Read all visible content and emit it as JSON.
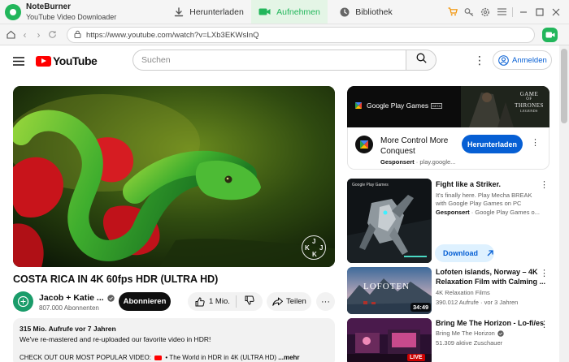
{
  "app": {
    "name": "NoteBurner",
    "subtitle": "YouTube Video Downloader",
    "tabs": [
      {
        "label": "Herunterladen",
        "icon": "download-icon"
      },
      {
        "label": "Aufnehmen",
        "icon": "camera-icon",
        "active": true
      },
      {
        "label": "Bibliothek",
        "icon": "clock-icon"
      }
    ],
    "accent": "#22b65b"
  },
  "browser": {
    "url": "https://www.youtube.com/watch?v=LXb3EKWsInQ"
  },
  "youtube": {
    "logo": "YouTube",
    "search_placeholder": "Suchen",
    "signin_label": "Anmelden"
  },
  "video": {
    "title": "COSTA RICA IN 4K 60fps HDR (ULTRA HD)",
    "channel": "Jacob + Katie ...",
    "subscribers": "807.000 Abonnenten",
    "subscribe_label": "Abonnieren",
    "likes": "1 Mio.",
    "share_label": "Teilen",
    "watermark": {
      "top": "J",
      "left": "K",
      "right": "J",
      "bottom": "K"
    }
  },
  "description": {
    "meta": "315 Mio. Aufrufe  vor 7 Jahren",
    "line1": "We've re-mastered and re-uploaded our favorite video in HDR!",
    "line2_a": "CHECK OUT OUR MOST POPULAR VIDEO:",
    "line2_b": "• The World in HDR in 4K (ULTRA HD)",
    "more": "...mehr"
  },
  "ad": {
    "banner_brand": "Google Play Games",
    "banner_beta": "BETA",
    "banner_game": [
      "GAME",
      "OF",
      "THRONES",
      "LEGENDS"
    ],
    "title": "More Control More Conquest",
    "sponsored": "Gesponsert",
    "domain": "play.google...",
    "button": "Herunterladen"
  },
  "sidebar": [
    {
      "title": "Fight like a Striker.",
      "desc1": "It's finally here. Play Mecha BREAK",
      "desc2": "with Google Play Games on PC",
      "sponsored": "Gesponsert",
      "meta": "Google Play Games o...",
      "button": "Download"
    },
    {
      "title_line1": "Lofoten islands, Norway – 4K",
      "title_line2": "Relaxation Film with Calming ...",
      "channel": "4K Relaxation Films",
      "views": "390.012 Aufrufe",
      "age": "vor 3 Jahren",
      "duration": "34:49",
      "thumb_text": "LOFOTEN"
    },
    {
      "title": "Bring Me The Horizon - Lo-fi/es",
      "channel": "Bring Me The Horizon",
      "views": "51.309 aktive Zuschauer",
      "badge": "LIVE"
    }
  ]
}
